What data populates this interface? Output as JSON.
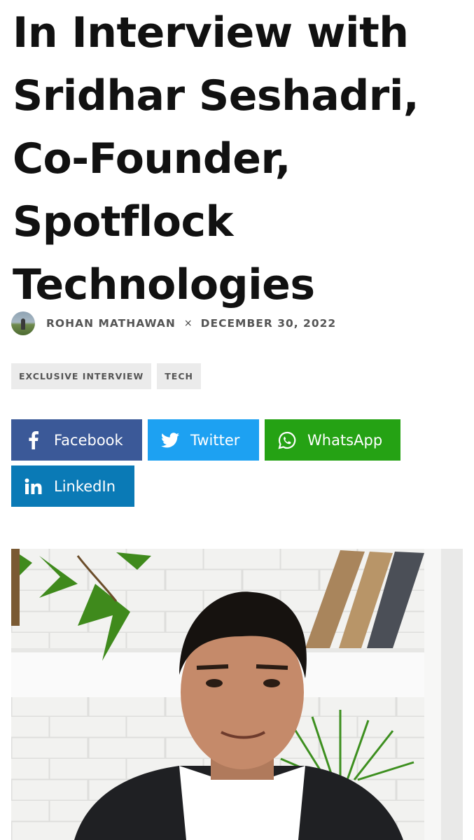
{
  "article": {
    "title": "In Interview with Sridhar Seshadri, Co-Founder, Spotflock Technologies",
    "author": "ROHAN MATHAWAN",
    "separator": "×",
    "date": "DECEMBER 30, 2022",
    "tags": [
      "EXCLUSIVE INTERVIEW",
      "TECH"
    ]
  },
  "share": {
    "facebook": {
      "label": "Facebook",
      "icon": "facebook-icon",
      "color": "#3b5998"
    },
    "twitter": {
      "label": "Twitter",
      "icon": "twitter-icon",
      "color": "#1da1f2"
    },
    "whatsapp": {
      "label": "WhatsApp",
      "icon": "whatsapp-icon",
      "color": "#25a214"
    },
    "linkedin": {
      "label": "LinkedIn",
      "icon": "linkedin-icon",
      "color": "#0a7ab6"
    }
  }
}
